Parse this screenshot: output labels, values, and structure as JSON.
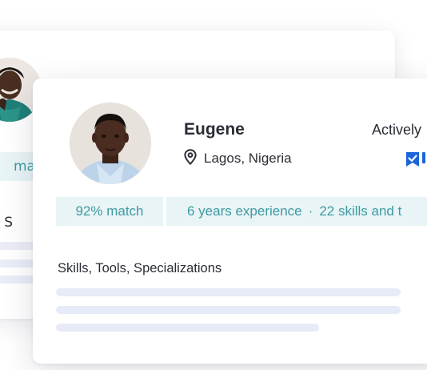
{
  "back_card": {
    "match_text": "matc",
    "skills_text": "ools, S"
  },
  "profile": {
    "name": "Eugene",
    "status": "Actively",
    "location": "Lagos, Nigeria"
  },
  "stats": {
    "match": "92% match",
    "experience": "6 years experience",
    "separator": "·",
    "skills": "22 skills and t"
  },
  "section": {
    "title": "Skills, Tools, Specializations"
  },
  "icons": {
    "location": "map-pin-icon",
    "bookmark": "bookmark-check-icon"
  },
  "colors": {
    "accent_teal": "#3f9aa3",
    "chip_bg": "#e8f4f5",
    "bookmark_blue": "#1c65d8",
    "skeleton_bar": "#e7eaf7"
  }
}
